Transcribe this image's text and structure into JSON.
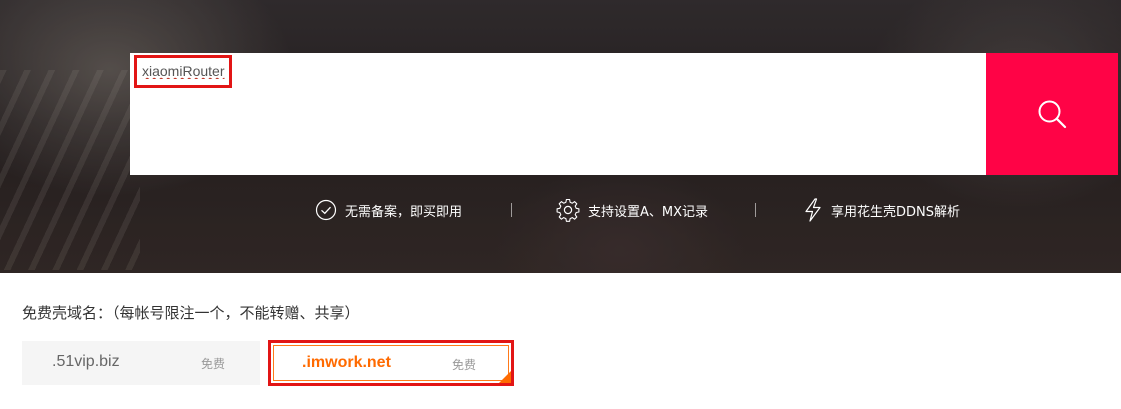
{
  "search": {
    "value": "xiaomiRouter",
    "button_icon": "search-icon",
    "button_color": "#ff0346"
  },
  "features": [
    {
      "icon": "check-circle-icon",
      "label": "无需备案，即买即用"
    },
    {
      "icon": "gear-icon",
      "label": "支持设置A、MX记录"
    },
    {
      "icon": "lightning-icon",
      "label": "享用花生壳DDNS解析"
    }
  ],
  "free_domains": {
    "title": "免费壳域名：（每帐号限注一个，不能转赠、共享）",
    "items": [
      {
        "name": ".51vip.biz",
        "tag": "免费",
        "selected": false
      },
      {
        "name": ".imwork.net",
        "tag": "免费",
        "selected": true
      }
    ]
  },
  "colors": {
    "accent": "#ff0346",
    "selected_domain": "#ff6a00",
    "highlight_box": "#e21515"
  }
}
